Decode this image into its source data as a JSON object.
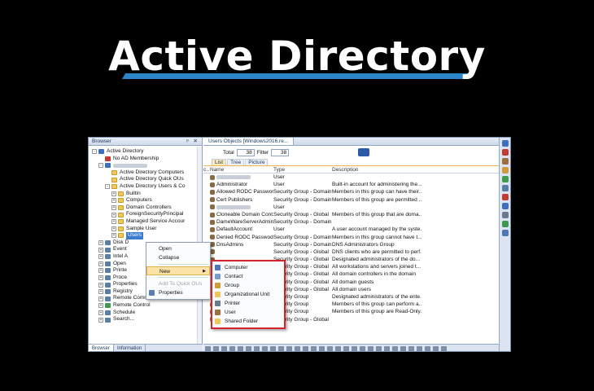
{
  "hero": {
    "title": "Active Directory"
  },
  "left_pane": {
    "title": "Browser",
    "controls": "ᵖ ✕",
    "tree": [
      {
        "label": "Active Directory",
        "exp": "-",
        "indent": 0,
        "icon": "ico-ad",
        "name": "tree-item-active-directory"
      },
      {
        "label": "No AD Membership",
        "exp": "",
        "indent": 1,
        "icon": "ico-red",
        "name": "tree-item-no-ad-membership"
      },
      {
        "label": "",
        "exp": "-",
        "indent": 1,
        "icon": "ico-ad",
        "blur": true,
        "name": "tree-item-domain"
      },
      {
        "label": "Active Directory Computers",
        "exp": "",
        "indent": 2,
        "icon": "ico-folder",
        "name": "tree-item-ad-computers"
      },
      {
        "label": "Active Directory Quick OUs",
        "exp": "",
        "indent": 2,
        "icon": "ico-folder",
        "name": "tree-item-ad-quick-ous"
      },
      {
        "label": "Active Directory Users & Co",
        "exp": "-",
        "indent": 2,
        "icon": "ico-folder",
        "name": "tree-item-ad-users"
      },
      {
        "label": "Builtin",
        "exp": "+",
        "indent": 3,
        "icon": "ico-folder",
        "name": "tree-item-builtin"
      },
      {
        "label": "Computers",
        "exp": "+",
        "indent": 3,
        "icon": "ico-folder",
        "name": "tree-item-computers"
      },
      {
        "label": "Domain Controllers",
        "exp": "+",
        "indent": 3,
        "icon": "ico-folder",
        "name": "tree-item-domain-controllers"
      },
      {
        "label": "ForeignSecurityPrincipal",
        "exp": "+",
        "indent": 3,
        "icon": "ico-folder",
        "name": "tree-item-foreign"
      },
      {
        "label": "Managed Service Accour",
        "exp": "+",
        "indent": 3,
        "icon": "ico-folder",
        "name": "tree-item-managed-service"
      },
      {
        "label": "Sample User",
        "exp": "+",
        "indent": 3,
        "icon": "ico-folder",
        "name": "tree-item-sample-user"
      },
      {
        "label": "Users",
        "exp": "+",
        "indent": 3,
        "icon": "ico-folder",
        "selected": true,
        "name": "tree-item-users"
      },
      {
        "label": "Disk D",
        "exp": "+",
        "indent": 1,
        "icon": "ico-gear",
        "name": "tree-item-disk"
      },
      {
        "label": "Event",
        "exp": "+",
        "indent": 1,
        "icon": "ico-gear",
        "name": "tree-item-event"
      },
      {
        "label": "Intel A",
        "exp": "+",
        "indent": 1,
        "icon": "ico-gear",
        "name": "tree-item-intel"
      },
      {
        "label": "Open",
        "exp": "+",
        "indent": 1,
        "icon": "ico-gear",
        "name": "tree-item-open"
      },
      {
        "label": "Printe",
        "exp": "+",
        "indent": 1,
        "icon": "ico-gear",
        "name": "tree-item-printers"
      },
      {
        "label": "Proce",
        "exp": "+",
        "indent": 1,
        "icon": "ico-gear",
        "name": "tree-item-processes"
      },
      {
        "label": "Properties",
        "exp": "+",
        "indent": 1,
        "icon": "ico-gear",
        "name": "tree-item-properties"
      },
      {
        "label": "Registry",
        "exp": "+",
        "indent": 1,
        "icon": "ico-gear",
        "name": "tree-item-registry"
      },
      {
        "label": "Remote Command",
        "exp": "+",
        "indent": 1,
        "icon": "ico-gear",
        "name": "tree-item-remote-command"
      },
      {
        "label": "Remote Control",
        "exp": "+",
        "indent": 1,
        "icon": "ico-green",
        "name": "tree-item-remote-control"
      },
      {
        "label": "Schedule",
        "exp": "+",
        "indent": 1,
        "icon": "ico-gear",
        "name": "tree-item-schedule"
      },
      {
        "label": "Search...",
        "exp": "+",
        "indent": 1,
        "icon": "ico-gear",
        "name": "tree-item-search"
      }
    ],
    "bottom_tabs": [
      {
        "label": "Browser",
        "active": true
      },
      {
        "label": "Information",
        "active": false
      }
    ]
  },
  "right_pane": {
    "doc_tab": "Users Objects [Windows2016.re...",
    "total_label": "Total",
    "total_value": "38",
    "filter_label": "Filter",
    "filter_value": "38",
    "view_tabs": [
      {
        "label": "List",
        "active": true
      },
      {
        "label": "Tree",
        "active": false
      },
      {
        "label": "Picture",
        "active": false
      }
    ],
    "columns": {
      "c0": "c..",
      "name": "Name",
      "type": "Type",
      "description": "Description"
    },
    "rows": [
      {
        "name": "",
        "type": "User",
        "description": "",
        "blur": true
      },
      {
        "name": "Administrator",
        "type": "User",
        "description": "Built-in account for administering the..."
      },
      {
        "name": "Allowed RODC Passwor...",
        "type": "Security Group - Domain ...",
        "description": "Members in this group can have their..."
      },
      {
        "name": "Cert Publishers",
        "type": "Security Group - Domain ...",
        "description": "Members of this group are permitted ..."
      },
      {
        "name": "",
        "type": "User",
        "description": "",
        "blur": true
      },
      {
        "name": "Cloneable Domain Cont...",
        "type": "Security Group - Global",
        "description": "Members of this group that are doma..."
      },
      {
        "name": "DameWareServerAdmins",
        "type": "Security Group - Domain ...",
        "description": ""
      },
      {
        "name": "DefaultAccount",
        "type": "User",
        "description": "A user account managed by the syste..."
      },
      {
        "name": "Denied RODC Passwod...",
        "type": "Security Group - Domain ...",
        "description": "Members in this group cannot have t..."
      },
      {
        "name": "DnsAdmins",
        "type": "Security Group - Domain ...",
        "description": "DNS Administrators Group"
      },
      {
        "name": "",
        "type": "Security Group - Global",
        "description": "DNS clients who are permitted to perf..."
      },
      {
        "name": "",
        "type": "Security Group - Global",
        "description": "Designated administrators of the do..."
      },
      {
        "name": "",
        "type": "Security Group - Global",
        "description": "All workstations and servers joined t..."
      },
      {
        "name": "",
        "type": "Security Group - Global",
        "description": "All domain controllers in the domain"
      },
      {
        "name": "",
        "type": "Security Group - Global",
        "description": "All domain guests"
      },
      {
        "name": "",
        "type": "Security Group - Global",
        "description": "All domain users"
      },
      {
        "name": "",
        "type": "Security Group",
        "description": "Designated administrators of the ente..."
      },
      {
        "name": "",
        "type": "Security Group",
        "description": "Members of this group can perform a..."
      },
      {
        "name": "",
        "type": "Security Group",
        "description": "Members of this group are Read-Only..."
      },
      {
        "name": "IT Techs",
        "type": "Security Group - Global",
        "description": ""
      }
    ]
  },
  "context_menu": {
    "items": [
      {
        "label": "Open",
        "disabled": false,
        "sep_after": false,
        "name": "ctx-open"
      },
      {
        "label": "Collapse",
        "disabled": false,
        "sep_after": true,
        "name": "ctx-collapse"
      },
      {
        "label": "New",
        "disabled": false,
        "sep_after": true,
        "hover": true,
        "arrow": "▶",
        "name": "ctx-new"
      },
      {
        "label": "Add To Quick OUs",
        "disabled": true,
        "sep_after": false,
        "name": "ctx-add-quick-ous"
      },
      {
        "label": "Properties",
        "disabled": false,
        "sep_after": false,
        "name": "ctx-properties"
      }
    ]
  },
  "submenu": {
    "items": [
      {
        "label": "Computer",
        "color": "#4e78b5",
        "name": "new-computer"
      },
      {
        "label": "Contact",
        "color": "#7a9cc8",
        "name": "new-contact"
      },
      {
        "label": "Group",
        "color": "#d29b3a",
        "name": "new-group"
      },
      {
        "label": "Organizational Unit",
        "color": "#f1c75a",
        "name": "new-ou"
      },
      {
        "label": "Printer",
        "color": "#6a7a8c",
        "name": "new-printer"
      },
      {
        "label": "User",
        "color": "#9d6f3f",
        "name": "new-user"
      },
      {
        "label": "Shared Folder",
        "color": "#f1c75a",
        "name": "new-shared-folder"
      }
    ]
  },
  "colors": {
    "accent": "#2a86c8",
    "highlight_border": "#d4232b",
    "menu_hover": "#fbe2a6"
  }
}
